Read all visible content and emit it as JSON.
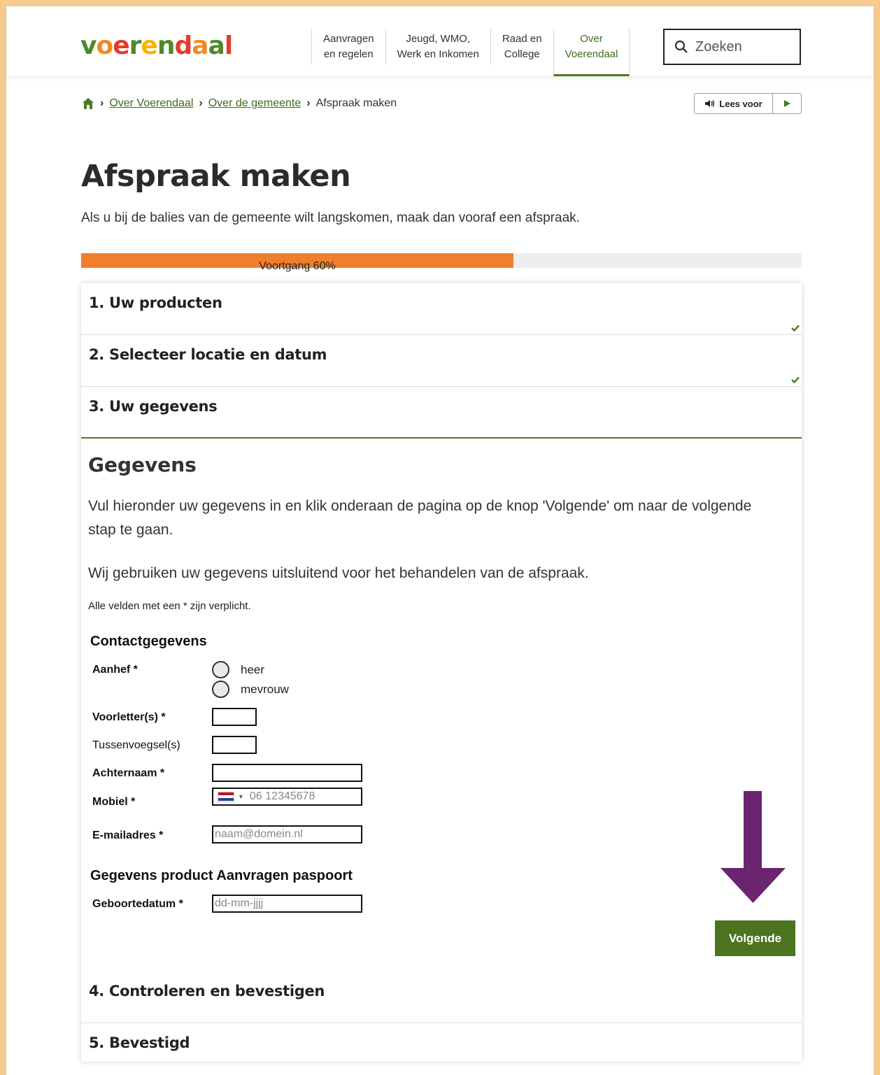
{
  "header": {
    "logo": [
      "v",
      "o",
      "e",
      "r",
      "e",
      "n",
      "d",
      "a",
      "a",
      "l"
    ],
    "logo_colors": [
      "#4d8a2a",
      "#f08a24",
      "#e23c2d",
      "#4d8a2a",
      "#f6b400",
      "#4d8a2a",
      "#e23c2d",
      "#f08a24",
      "#4d8a2a",
      "#e23c2d"
    ],
    "nav": [
      {
        "line1": "Aanvragen",
        "line2": "en regelen"
      },
      {
        "line1": "Jeugd, WMO,",
        "line2": "Werk en Inkomen"
      },
      {
        "line1": "Raad en",
        "line2": "College"
      },
      {
        "line1": "Over",
        "line2": "Voerendaal"
      }
    ],
    "search_placeholder": "Zoeken"
  },
  "breadcrumb": {
    "items": [
      "Over Voerendaal",
      "Over de gemeente"
    ],
    "current": "Afspraak maken"
  },
  "readspeaker": {
    "label": "Lees voor"
  },
  "page": {
    "title": "Afspraak maken",
    "intro": "Als u bij de balies van de gemeente wilt langskomen, maak dan vooraf een afspraak."
  },
  "progress": {
    "label": "Voortgang 60%",
    "value": 0.6
  },
  "steps": [
    {
      "title": "1. Uw producten",
      "done": true
    },
    {
      "title": "2. Selecteer locatie en datum",
      "done": true
    },
    {
      "title": "3. Uw gegevens",
      "done": false
    },
    {
      "title": "4. Controleren en bevestigen",
      "done": false
    },
    {
      "title": "5. Bevestigd",
      "done": false
    }
  ],
  "form": {
    "heading": "Gegevens",
    "text1": "Vul hieronder uw gegevens in en klik onderaan de pagina op de knop 'Volgende' om naar de volgende stap te gaan.",
    "text2": "Wij gebruiken uw gegevens uitsluitend voor het behandelen van de afspraak.",
    "note": "Alle velden met een * zijn verplicht.",
    "contact_title": "Contactgegevens",
    "labels": {
      "aanhef": "Aanhef *",
      "voorletters": "Voorletter(s) *",
      "tussenvoegsel": "Tussenvoegsel(s)",
      "achternaam": "Achternaam *",
      "mobiel": "Mobiel *",
      "email": "E-mailadres *",
      "geboortedatum": "Geboortedatum *"
    },
    "radio_options": [
      "heer",
      "mevrouw"
    ],
    "mobile_placeholder": "06 12345678",
    "email_placeholder": "naam@domein.nl",
    "product_title": "Gegevens product Aanvragen paspoort",
    "date_placeholder": "dd-mm-jjjj",
    "next_label": "Volgende"
  },
  "colors": {
    "accent": "#4b7320",
    "progress": "#f07f2b",
    "arrow": "#6a2470",
    "frame": "#f6c98e"
  }
}
